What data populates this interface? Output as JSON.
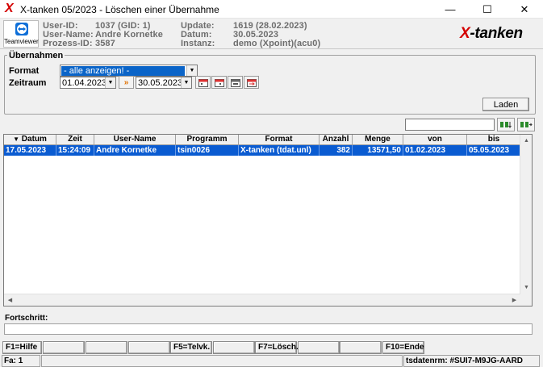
{
  "window": {
    "title": "X-tanken 05/2023 - Löschen einer Übernahme",
    "app_icon": "X",
    "minimize_glyph": "—",
    "maximize_glyph": "☐",
    "close_glyph": "✕"
  },
  "header": {
    "teamviewer_label": "Teamviewer",
    "brand_x": "X",
    "brand_rest": "-tanken",
    "info": [
      {
        "label": "User-ID:",
        "value": "1037 (GID: 1)"
      },
      {
        "label": "User-Name:",
        "value": "Andre Kornetke"
      },
      {
        "label": "Prozess-ID:",
        "value": "3587"
      },
      {
        "label": "Update:",
        "value": "1619 (28.02.2023)"
      },
      {
        "label": "Datum:",
        "value": "30.05.2023"
      },
      {
        "label": "Instanz:",
        "value": "demo (Xpoint)(acu0)"
      }
    ]
  },
  "filter": {
    "group_title": "Übernahmen",
    "format_label": "Format",
    "format_value": "- alle anzeigen! -",
    "zeitraum_label": "Zeitraum",
    "date_from": "01.04.2023",
    "date_to": "30.05.2023",
    "laden_label": "Laden"
  },
  "table": {
    "columns": [
      "Datum",
      "Zeit",
      "User-Name",
      "Programm",
      "Format",
      "Anzahl",
      "Menge",
      "von",
      "bis"
    ],
    "sort_indicator": "▼",
    "rows": [
      [
        "17.05.2023",
        "15:24:09",
        "Andre Kornetke",
        "tsin0026",
        "X-tanken (tdat.unl)",
        "382",
        "13571,50",
        "01.02.2023",
        "05.05.2023"
      ]
    ]
  },
  "progress": {
    "label": "Fortschritt:",
    "value": 0
  },
  "fkeys": [
    "F1=Hilfe",
    "",
    "",
    "",
    "F5=Telvk.",
    "",
    "F7=Lösch.",
    "",
    "",
    "F10=Ende"
  ],
  "status": {
    "left": "Fa: 1",
    "right": "tsdatenrm: #SUI7-M9JG-AARD"
  },
  "colors": {
    "selection": "#0a5bd1",
    "brand_red": "#d40000",
    "window_bg": "#f0f0f0"
  },
  "icons": {
    "date_from_picker": "double-chevron-right-icon",
    "calendar_buttons": [
      "calendar-icon",
      "calendar-icon",
      "calendar-icon",
      "calendar-range-icon"
    ],
    "search_buttons": [
      "find-down-icon",
      "find-next-icon"
    ]
  }
}
